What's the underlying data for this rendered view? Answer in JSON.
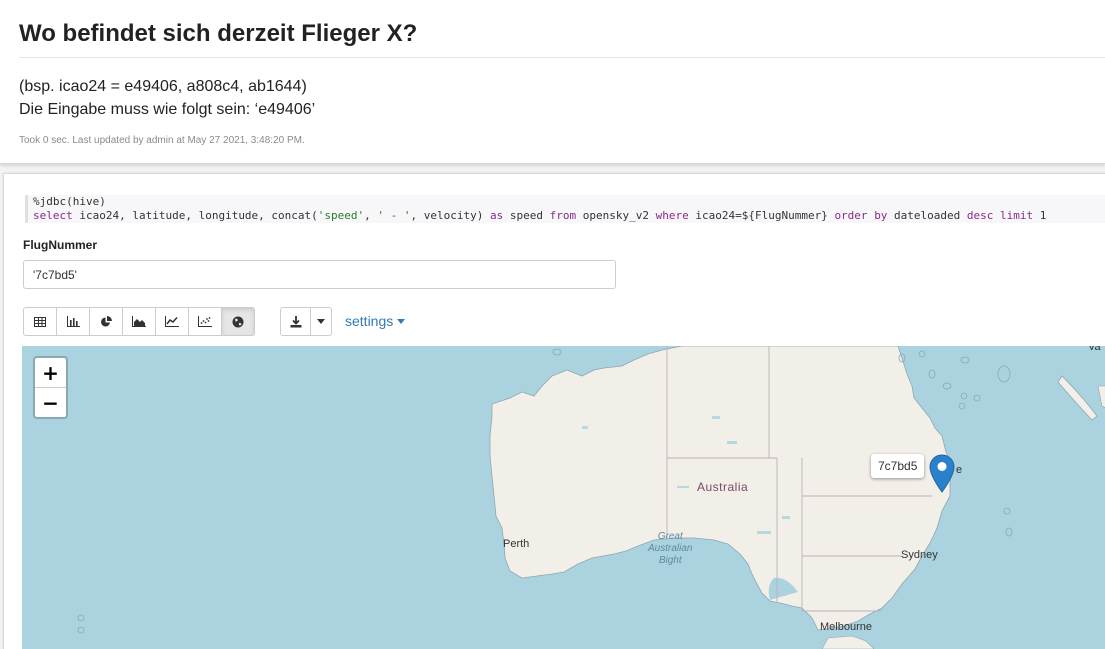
{
  "header": {
    "title": "Wo befindet sich derzeit Flieger X?",
    "example": "(bsp. icao24 = e49406, a808c4, ab1644)",
    "instruction": "Die Eingabe muss wie folgt sein: ‘e49406’",
    "meta": "Took 0 sec. Last updated by admin at May 27 2021, 3:48:20 PM."
  },
  "paragraph": {
    "code_line1": "%jdbc(hive)",
    "code": {
      "kw_select": "select",
      "cols": " icao24, latitude, longitude, concat(",
      "str_speed": "'speed'",
      "mid1": ", ",
      "str_dash": "' - '",
      "mid2": ", velocity) ",
      "kw_as": "as",
      "mid3": " speed ",
      "kw_from": "from",
      "mid4": " opensky_v2 ",
      "kw_where": "where",
      "mid5": " icao24=${FlugNummer} ",
      "kw_order": "order",
      "mid6": " ",
      "kw_by": "by",
      "mid7": " dateloaded ",
      "kw_desc": "desc",
      "mid8": " ",
      "kw_limit": "limit",
      "tail": " 1"
    },
    "param_label": "FlugNummer",
    "param_value": "'7c7bd5'",
    "visualizations": [
      "table-icon",
      "bar-chart-icon",
      "pie-chart-icon",
      "area-chart-icon",
      "line-chart-icon",
      "scatter-chart-icon",
      "globe-icon"
    ],
    "active_visualization": "globe-icon",
    "settings_label": "settings"
  },
  "map": {
    "zoom_in": "+",
    "zoom_out": "−",
    "labels": {
      "australia": "Australia",
      "perth": "Perth",
      "sydney": "Sydney",
      "melbourne": "Melbourne",
      "brisbane_partial": "e",
      "sea_line1": "Great",
      "sea_line2": "Australian",
      "sea_line3": "Bight",
      "corner": "Va"
    },
    "tooltip": "7c7bd5",
    "marker_color": "#2a81cb"
  }
}
